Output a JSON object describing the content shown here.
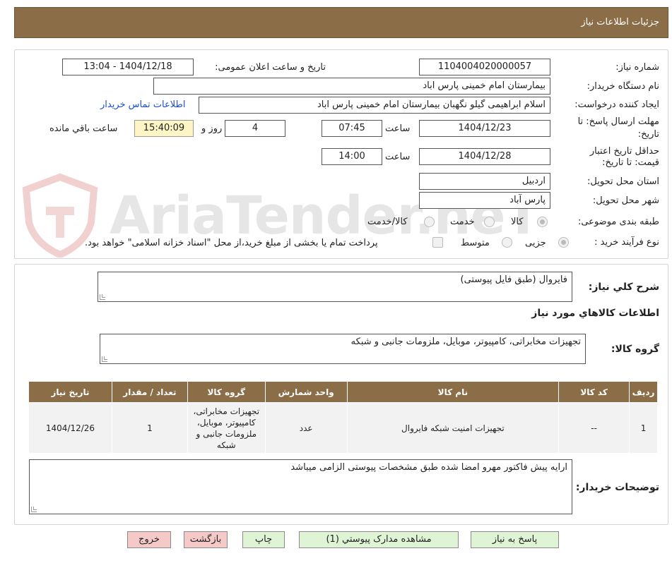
{
  "header": {
    "title": "جزئیات اطلاعات نیاز"
  },
  "watermark": {
    "text": "AriaTender.neT"
  },
  "info": {
    "need_number_label": "شماره نیاز:",
    "need_number": "1104004020000057",
    "announce_label": "تاریخ و ساعت اعلان عمومی:",
    "announce_value": "1404/12/18 - 13:04",
    "buyer_org_label": "نام دستگاه خریدار:",
    "buyer_org": "بیمارستان امام خمینی پارس اباد",
    "creator_label": "ایجاد کننده درخواست:",
    "creator": "اسلام ابراهیمی گیلو نگهبان بیمارستان امام خمینی پارس اباد",
    "contact_link": "اطلاعات تماس خریدار",
    "deadline_label_1": "مهلت ارسال پاسخ: تا",
    "deadline_label_2": "تاریخ:",
    "deadline_date": "1404/12/23",
    "time_label": "ساعت",
    "deadline_time": "07:45",
    "days_value": "4",
    "days_label": "روز و",
    "remaining_time": "15:40:09",
    "remaining_label": "ساعت باقي مانده",
    "validity_label_1": "حداقل تاریخ اعتبار",
    "validity_label_2": "قیمت: تا تاریخ:",
    "validity_date": "1404/12/28",
    "validity_time": "14:00",
    "province_label": "استان محل تحویل:",
    "province": "اردبیل",
    "city_label": "شهر محل تحویل:",
    "city": "پارس آباد",
    "category_label": "طبقه بندی موضوعی:",
    "category_options": [
      "کالا",
      "خدمت",
      "کالا/خدمت"
    ],
    "process_label": "نوع فرآیند خرید :",
    "process_options": [
      "جزیی",
      "متوسط"
    ],
    "payment_note": "پرداخت تمام یا بخشی از مبلغ خرید،از محل \"اسناد خزانه اسلامی\" خواهد بود."
  },
  "details": {
    "summary_label": "شرح کلي نياز:",
    "summary": "فایروال (طبق فایل پیوستی)",
    "goods_section_title": "اطلاعات کالاهاي مورد نياز",
    "goods_group_label": "گروه کالا:",
    "goods_group": "تجهیزات مخابراتی، کامپیوتر، موبایل، ملزومات جانبی و شبکه",
    "table": {
      "headers": [
        "ردیف",
        "کد کالا",
        "نام کالا",
        "واحد شمارش",
        "گروه کالا",
        "تعداد / مقدار",
        "تاریخ نیاز"
      ],
      "rows": [
        [
          "1",
          "--",
          "تجهیزات امنیت شبکه فایروال",
          "عدد",
          "تجهیزات مخابراتی، کامپیوتر، موبایل، ملزومات جانبی و شبکه",
          "1",
          "1404/12/26"
        ]
      ]
    },
    "buyer_notes_label": "توضیحات خریدار:",
    "buyer_notes": "ارایه پیش فاکتور مهرو امضا شده طبق مشخصات پیوستی الزامی میباشد"
  },
  "buttons": {
    "reply": "پاسخ به نیاز",
    "attachments": "مشاهده مدارک پیوستي (1)",
    "print": "چاپ",
    "back": "بازگشت",
    "exit": "خروج"
  }
}
